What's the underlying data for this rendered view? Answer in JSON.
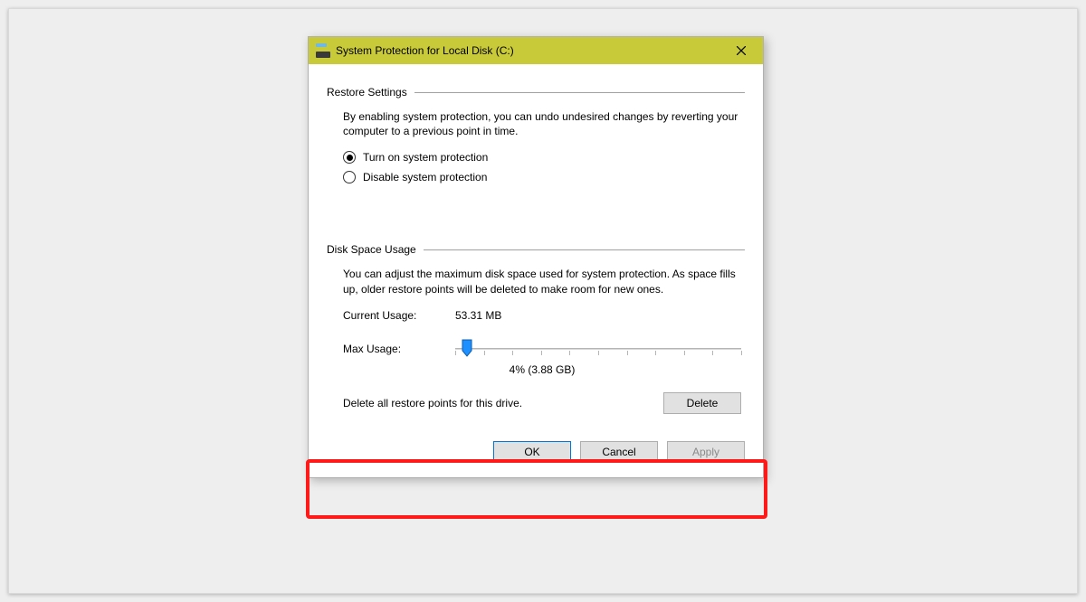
{
  "window": {
    "title": "System Protection for Local Disk (C:)"
  },
  "restore": {
    "heading": "Restore Settings",
    "description": "By enabling system protection, you can undo undesired changes by reverting your computer to a previous point in time.",
    "option_on": "Turn on system protection",
    "option_off": "Disable system protection",
    "selected": "on"
  },
  "disk": {
    "heading": "Disk Space Usage",
    "description": "You can adjust the maximum disk space used for system protection. As space fills up, older restore points will be deleted to make room for new ones.",
    "current_label": "Current Usage:",
    "current_value": "53.31 MB",
    "max_label": "Max Usage:",
    "slider_percent": 4,
    "readout": "4% (3.88 GB)"
  },
  "delete": {
    "text": "Delete all restore points for this drive.",
    "button": "Delete"
  },
  "footer": {
    "ok": "OK",
    "cancel": "Cancel",
    "apply": "Apply"
  }
}
